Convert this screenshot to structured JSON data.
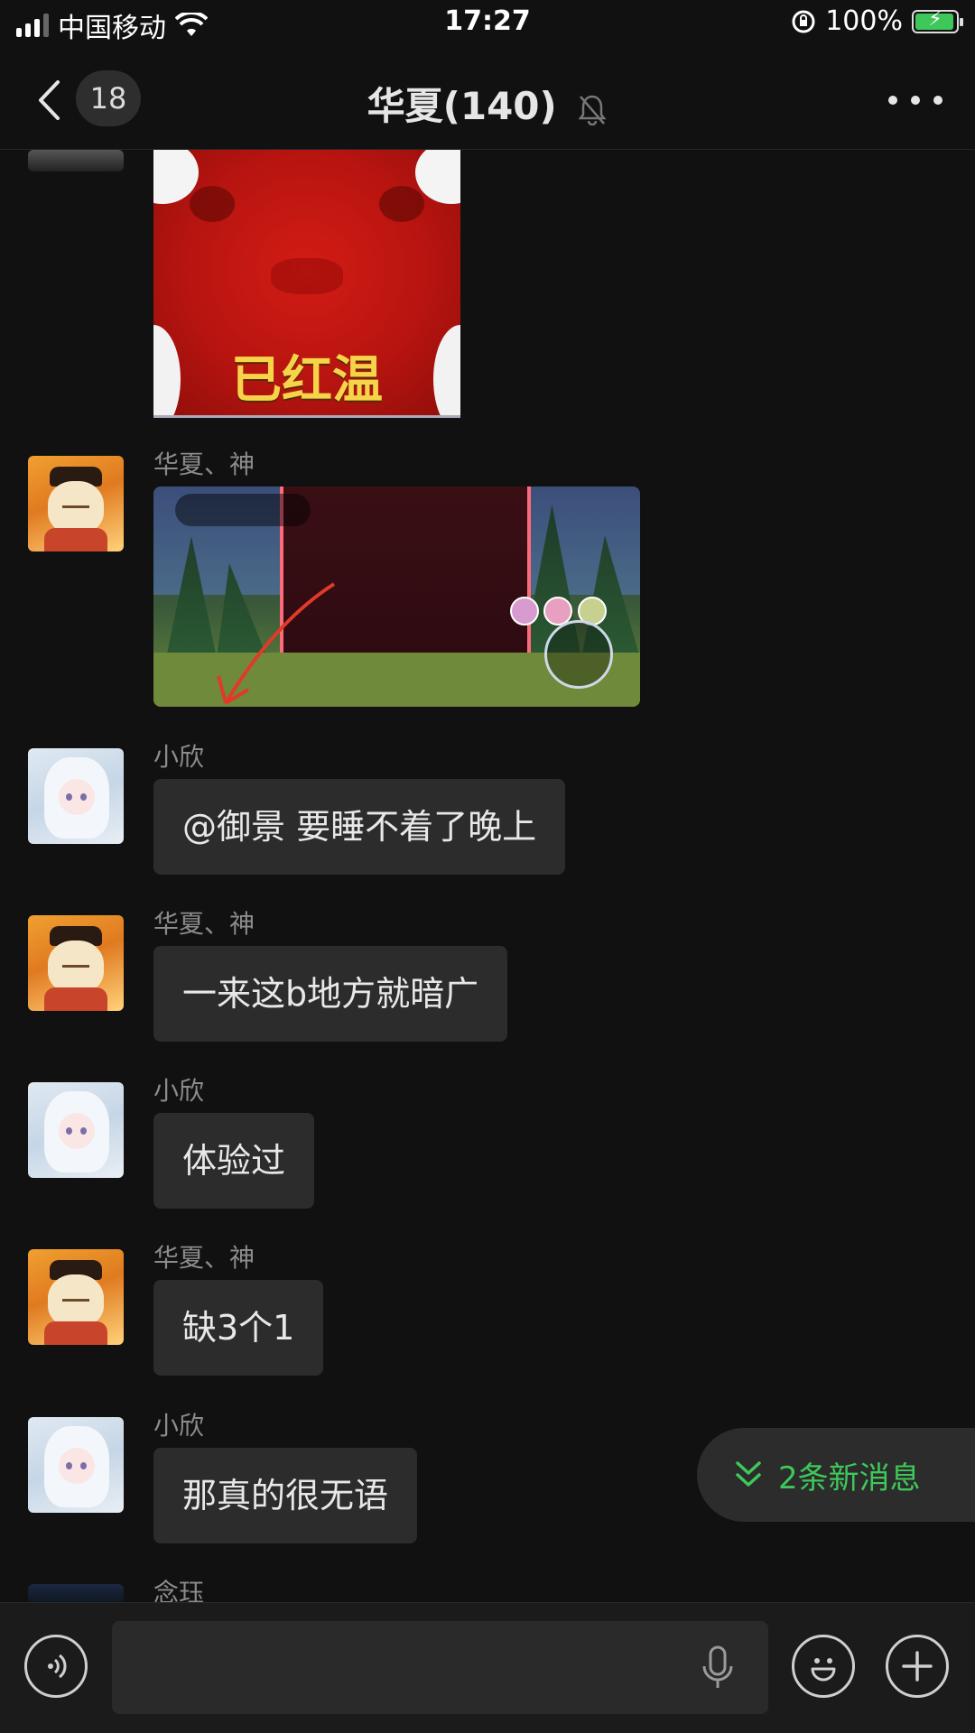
{
  "status_bar": {
    "carrier": "中国移动",
    "time": "17:27",
    "battery": "100%"
  },
  "nav": {
    "back_count": "18",
    "title": "华夏(140)"
  },
  "messages": [
    {
      "sender": "",
      "type": "sticker",
      "caption": "已红温"
    },
    {
      "sender": "华夏、神",
      "type": "image"
    },
    {
      "sender": "小欣",
      "type": "text",
      "text": "@御景 要睡不着了晚上"
    },
    {
      "sender": "华夏、神",
      "type": "text",
      "text": "一来这b地方就暗广"
    },
    {
      "sender": "小欣",
      "type": "text",
      "text": "体验过"
    },
    {
      "sender": "华夏、神",
      "type": "text",
      "text": "缺3个1"
    },
    {
      "sender": "小欣",
      "type": "text",
      "text": "那真的很无语"
    },
    {
      "sender": "念珏",
      "type": "partial"
    }
  ],
  "new_messages": "2条新消息",
  "colors": {
    "background": "#111111",
    "bubble": "#2c2c2c",
    "accent_green": "#3ec85a",
    "sender_name": "#8c8c8c"
  },
  "icons": [
    "back-icon",
    "mute-bell-icon",
    "more-icon",
    "voice-icon",
    "mic-icon",
    "emoji-icon",
    "plus-icon",
    "double-chevron-down-icon"
  ]
}
